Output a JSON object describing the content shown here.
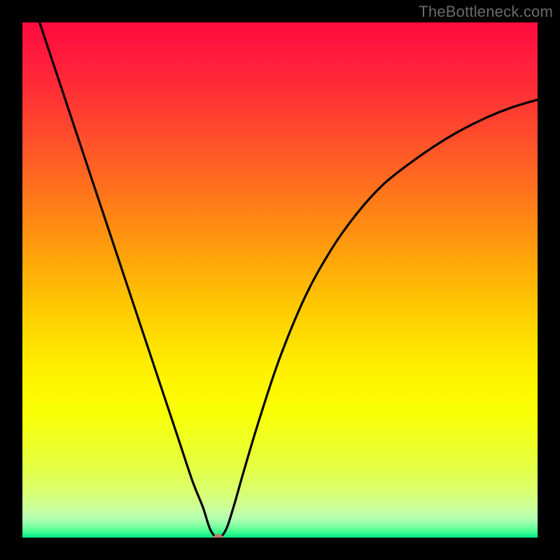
{
  "watermark": "TheBottleneck.com",
  "chart_data": {
    "type": "line",
    "title": "",
    "xlabel": "",
    "ylabel": "",
    "xlim": [
      0,
      100
    ],
    "ylim": [
      0,
      100
    ],
    "optimum_x": 38,
    "series": [
      {
        "name": "bottleneck-curve",
        "x": [
          0,
          5,
          10,
          15,
          20,
          25,
          30,
          33,
          35,
          36.5,
          38,
          39.5,
          41,
          43,
          46,
          50,
          55,
          60,
          65,
          70,
          75,
          80,
          85,
          90,
          95,
          100
        ],
        "values": [
          110,
          95,
          80,
          65,
          50,
          35,
          20,
          11,
          6,
          1.5,
          0,
          1.5,
          6,
          13,
          23,
          35,
          47,
          56,
          63,
          68.5,
          72.5,
          76,
          79,
          81.5,
          83.5,
          85
        ]
      }
    ],
    "background_gradient": {
      "stops": [
        {
          "offset": 0.0,
          "color": "#ff0b3f"
        },
        {
          "offset": 0.06,
          "color": "#ff1a3c"
        },
        {
          "offset": 0.13,
          "color": "#ff2e36"
        },
        {
          "offset": 0.2,
          "color": "#ff462e"
        },
        {
          "offset": 0.27,
          "color": "#ff5e25"
        },
        {
          "offset": 0.34,
          "color": "#ff781a"
        },
        {
          "offset": 0.41,
          "color": "#ff9210"
        },
        {
          "offset": 0.48,
          "color": "#ffad08"
        },
        {
          "offset": 0.55,
          "color": "#ffc802"
        },
        {
          "offset": 0.62,
          "color": "#ffe000"
        },
        {
          "offset": 0.69,
          "color": "#fff400"
        },
        {
          "offset": 0.76,
          "color": "#f9ff07"
        },
        {
          "offset": 0.82,
          "color": "#edff28"
        },
        {
          "offset": 0.87,
          "color": "#e3ff4a"
        },
        {
          "offset": 0.905,
          "color": "#daff6a"
        },
        {
          "offset": 0.93,
          "color": "#d1ff88"
        },
        {
          "offset": 0.95,
          "color": "#c4ffa4"
        },
        {
          "offset": 0.965,
          "color": "#aeffb0"
        },
        {
          "offset": 0.978,
          "color": "#7effa0"
        },
        {
          "offset": 0.988,
          "color": "#44ff92"
        },
        {
          "offset": 1.0,
          "color": "#00e885"
        }
      ]
    },
    "marker": {
      "x": 38,
      "y": 0,
      "rx": 7,
      "ry": 5
    }
  }
}
